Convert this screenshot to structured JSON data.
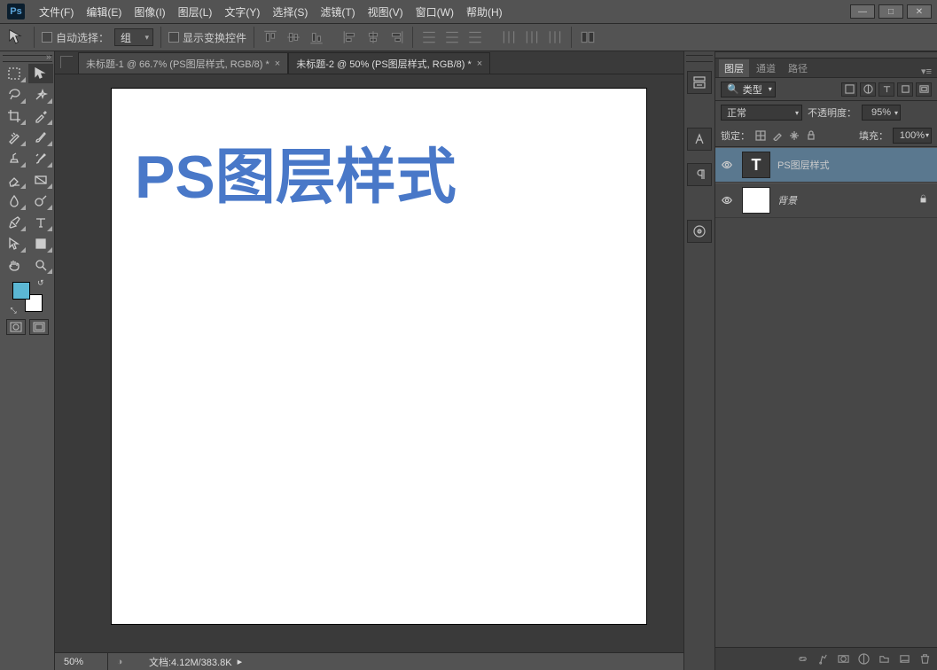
{
  "app": {
    "logo": "Ps"
  },
  "menu": {
    "file": "文件(F)",
    "edit": "编辑(E)",
    "image": "图像(I)",
    "layer": "图层(L)",
    "type": "文字(Y)",
    "select": "选择(S)",
    "filter": "滤镜(T)",
    "view": "视图(V)",
    "window": "窗口(W)",
    "help": "帮助(H)"
  },
  "options": {
    "auto_select_label": "自动选择：",
    "group_label": "组",
    "show_transform_label": "显示变换控件"
  },
  "tabs": {
    "tab1": "未标题-1 @ 66.7% (PS图层样式, RGB/8) *",
    "tab2": "未标题-2 @ 50% (PS图层样式, RGB/8) *"
  },
  "canvas": {
    "text": "PS图层样式",
    "text_color": "#4978c8"
  },
  "status": {
    "zoom": "50%",
    "doc": "文档:4.12M/383.8K"
  },
  "panel_tabs": {
    "layers": "图层",
    "channels": "通道",
    "paths": "路径"
  },
  "layer_filter": {
    "kind_icon": "🔎",
    "kind_label": "类型"
  },
  "blend": {
    "mode": "正常",
    "opacity_label": "不透明度：",
    "opacity_value": "95%"
  },
  "lock": {
    "label": "锁定：",
    "fill_label": "填充：",
    "fill_value": "100%"
  },
  "layers": {
    "text_layer": "PS图层样式",
    "background": "背景",
    "text_thumb_glyph": "T"
  },
  "swatch": {
    "fg": "#5bb7d4",
    "bg": "#ffffff"
  }
}
